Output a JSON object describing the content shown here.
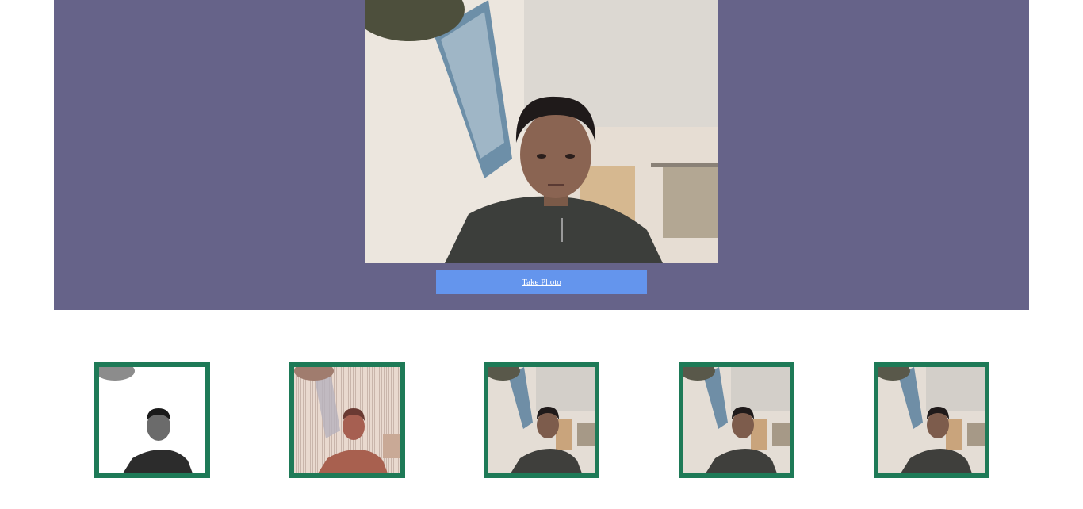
{
  "camera": {
    "feed_icon": "webcam-video-feed",
    "take_photo_label": "Take Photo"
  },
  "gallery": {
    "thumbnails": [
      {
        "filter": "grayscale-high-contrast"
      },
      {
        "filter": "sepia-striped"
      },
      {
        "filter": "normal"
      },
      {
        "filter": "normal"
      },
      {
        "filter": "normal"
      }
    ],
    "border_color": "#1e7a57"
  },
  "colors": {
    "panel_bg": "#666389",
    "button_bg": "#6495ed"
  }
}
